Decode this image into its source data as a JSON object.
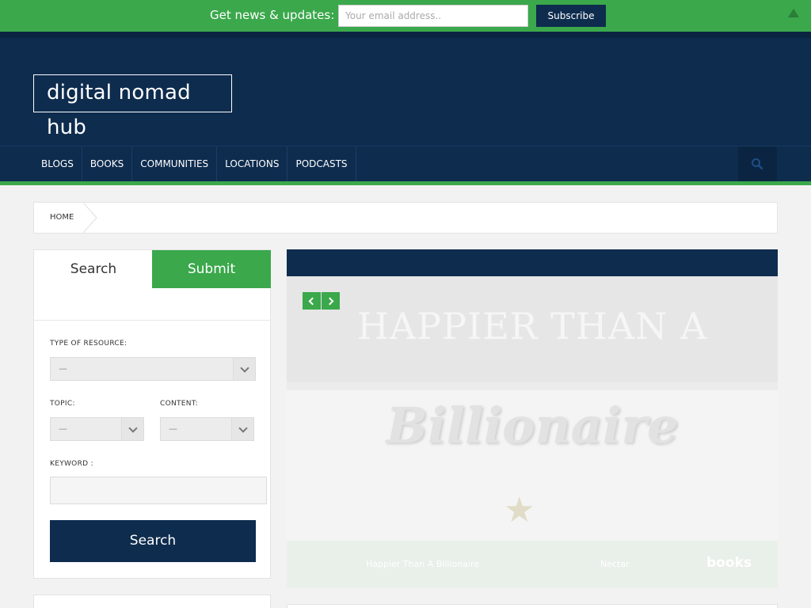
{
  "topbar": {
    "label": "Get news & updates:",
    "email_placeholder": "Your email address..",
    "subscribe_label": "Subscribe"
  },
  "header": {
    "logo": "digital nomad hub"
  },
  "nav": {
    "items": [
      {
        "label": "BLOGS"
      },
      {
        "label": "BOOKS"
      },
      {
        "label": "COMMUNITIES"
      },
      {
        "label": "LOCATIONS"
      },
      {
        "label": "PODCASTS"
      }
    ],
    "search_icon": "search-icon"
  },
  "breadcrumb": {
    "home": "HOME"
  },
  "search_panel": {
    "tabs": [
      {
        "label": "Search"
      },
      {
        "label": "Submit"
      }
    ],
    "type_label": "TYPE OF RESOURCE:",
    "type_value": "—",
    "topic_label": "TOPIC:",
    "topic_value": "—",
    "content_label": "CONTENT:",
    "content_value": "—",
    "keyword_label": "KEYWORD :",
    "keyword_value": "",
    "search_button": "Search"
  },
  "slider": {
    "image_text_line1": "HAPPIER THAN A",
    "image_text_line2": "Billionaire",
    "caption_title": "Happier Than A Billionaire",
    "caption_type": "Nectar",
    "caption_category": "books"
  },
  "colors": {
    "green": "#3aa84b",
    "navy": "#0e2c4e"
  }
}
